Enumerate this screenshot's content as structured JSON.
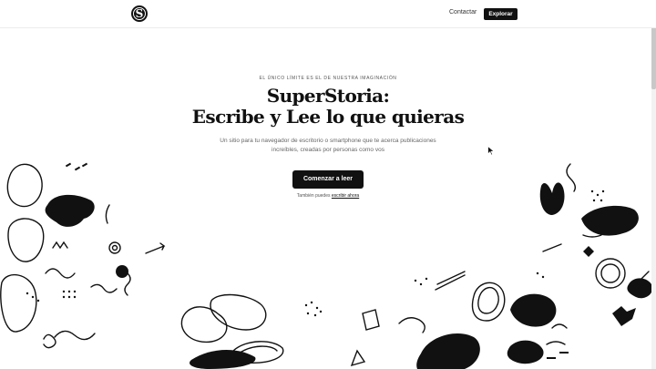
{
  "header": {
    "logo_letter": "S",
    "contact_label": "Contactar",
    "explore_label": "Explorar"
  },
  "hero": {
    "eyebrow": "EL ÚNICO LÍMITE ES EL DE NUESTRA IMAGINACIÓN",
    "title_line1": "SuperStoria:",
    "title_line2": "Escribe y Lee lo que quieras",
    "subtitle_line1": "Un sitio para tu navegador de escritorio o smartphone que te acerca publicaciones",
    "subtitle_line2": "increíbles, creadas por personas como vos",
    "cta_label": "Comenzar a leer",
    "secondary_prefix": "También puedes",
    "secondary_link": "escribir ahora"
  },
  "colors": {
    "ink": "#111111",
    "background": "#ffffff",
    "muted": "#666666"
  }
}
